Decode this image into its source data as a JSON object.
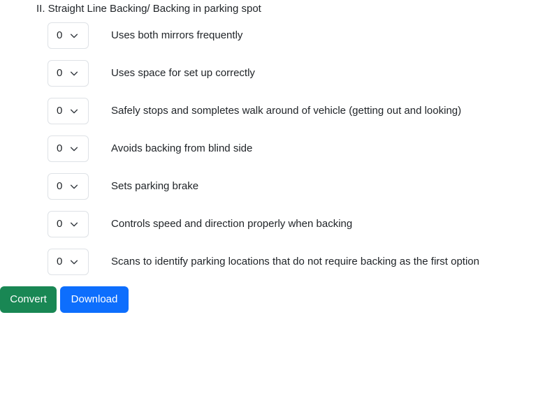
{
  "section": {
    "title": "II. Straight Line Backing/ Backing in parking spot"
  },
  "items": [
    {
      "score": "0",
      "label": "Uses both mirrors frequently"
    },
    {
      "score": "0",
      "label": "Uses space for set up correctly"
    },
    {
      "score": "0",
      "label": "Safely stops and sompletes walk around of vehicle (getting out and looking)"
    },
    {
      "score": "0",
      "label": "Avoids backing from blind side"
    },
    {
      "score": "0",
      "label": "Sets parking brake"
    },
    {
      "score": "0",
      "label": "Controls speed and direction properly when backing"
    },
    {
      "score": "0",
      "label": "Scans to identify parking locations that do not require backing as the first option"
    }
  ],
  "actions": {
    "convert_label": "Convert",
    "download_label": "Download"
  },
  "colors": {
    "convert": "#198754",
    "download": "#0d6efd",
    "select_border": "#dee2e6",
    "text": "#212529"
  },
  "icons": {
    "select_indicator": "chevron-down-icon"
  }
}
